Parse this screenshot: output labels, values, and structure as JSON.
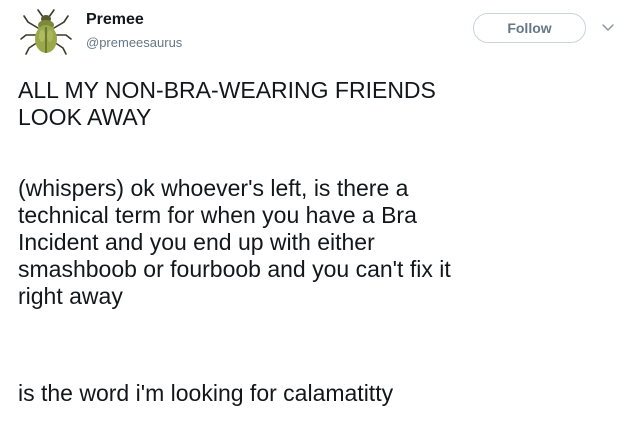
{
  "tweet": {
    "user": {
      "display_name": "Premee",
      "handle": "@premeesaurus",
      "avatar_icon": "beetle-icon"
    },
    "follow_label": "Follow",
    "more_icon": "chevron-down-icon",
    "paragraphs": {
      "headline": "ALL MY NON-BRA-WEARING FRIENDS\nLOOK AWAY",
      "whisper": "(whispers) ok whoever's left, is there a\ntechnical term for when you have a Bra\nIncident and you end up with either\nsmashboob or fourboob and you can't fix it\nright away",
      "ending": "is the word i'm looking for calamatitty"
    }
  },
  "colors": {
    "text": "#14171a",
    "secondary_text": "#657786",
    "button_border": "#c9d4dc",
    "background": "#ffffff"
  }
}
